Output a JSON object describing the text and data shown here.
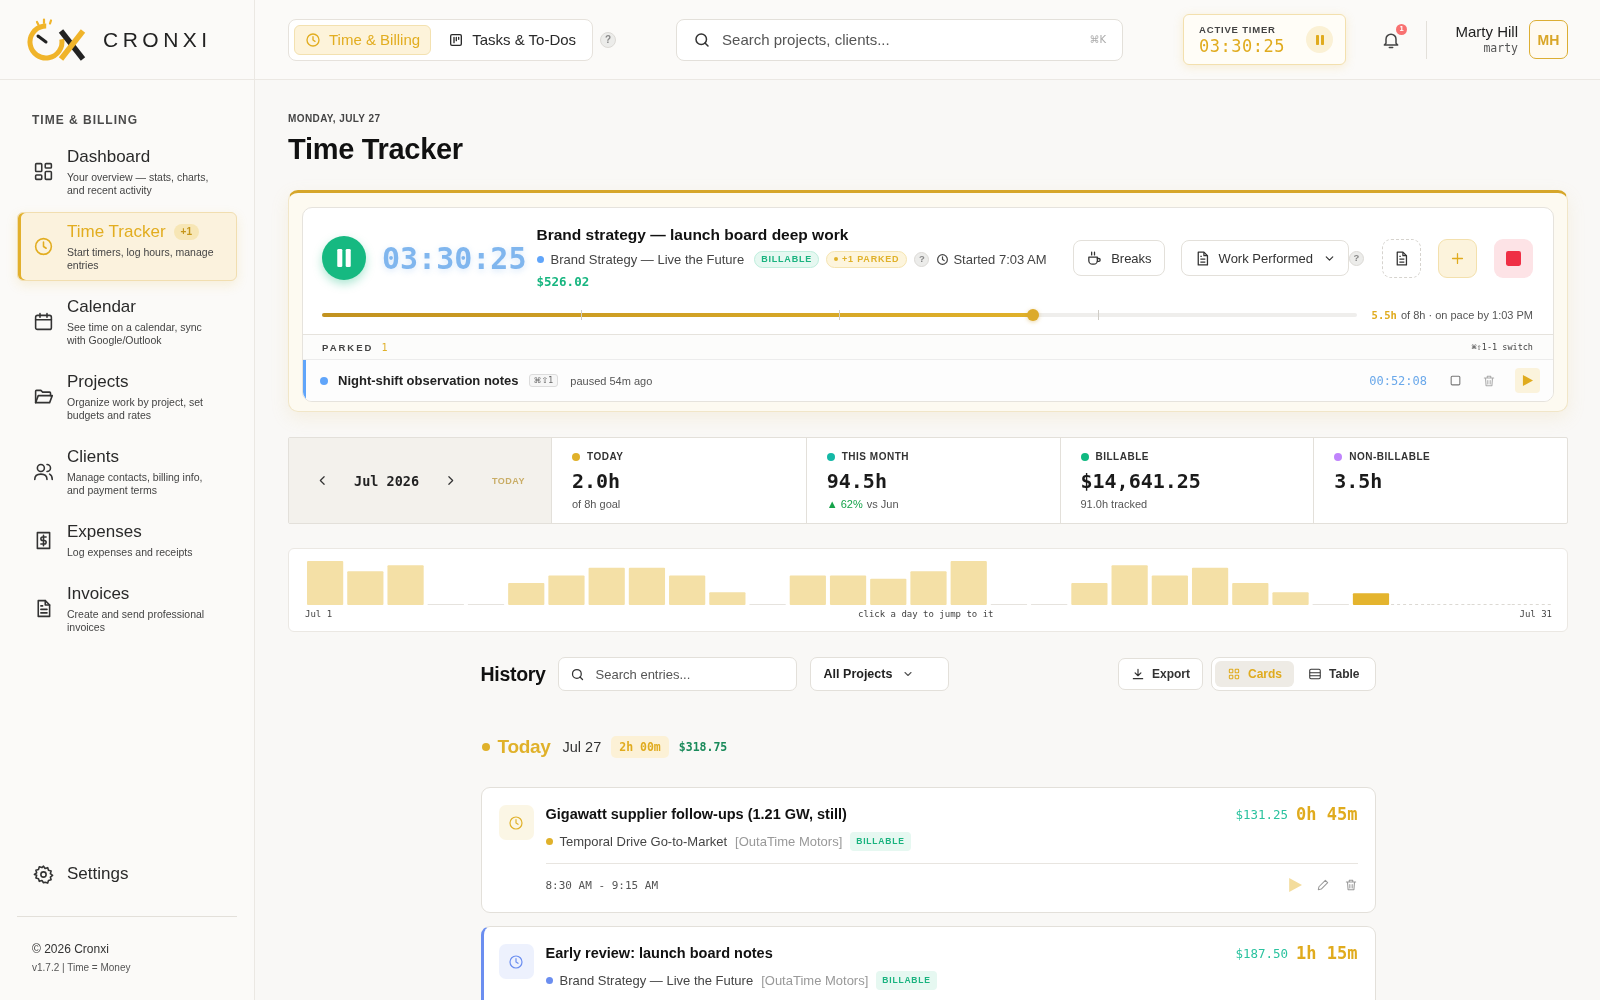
{
  "sidebar": {
    "brand": "CRONXI",
    "section_label": "TIME & BILLING",
    "items": [
      {
        "label": "Dashboard",
        "description": "Your overview — stats, charts, and recent activity",
        "selected": false
      },
      {
        "label": "Time Tracker",
        "badge": "+1",
        "description": "Start timers, log hours, manage entries",
        "selected": true
      },
      {
        "label": "Calendar",
        "description": "See time on a calendar, sync with Google/Outlook",
        "selected": false
      },
      {
        "label": "Projects",
        "description": "Organize work by project, set budgets and rates",
        "selected": false
      },
      {
        "label": "Clients",
        "description": "Manage contacts, billing info, and payment terms",
        "selected": false
      },
      {
        "label": "Expenses",
        "description": "Log expenses and receipts",
        "selected": false
      },
      {
        "label": "Invoices",
        "description": "Create and send professional invoices",
        "selected": false
      }
    ],
    "settings": "Settings",
    "copyright": "© 2026 Cronxi",
    "version": "v1.7.2 | Time = Money"
  },
  "topbar": {
    "modules": [
      {
        "label": "Time & Billing",
        "selected": true
      },
      {
        "label": "Tasks & To-Dos",
        "selected": false
      }
    ],
    "help": "?",
    "search": {
      "placeholder": "Search projects, clients...",
      "shortcut": "⌘K"
    },
    "active_timer": {
      "label": "ACTIVE TIMER",
      "time": "03:30:25",
      "running": true
    },
    "notifications": {
      "count": "1"
    },
    "user": {
      "name": "Marty Hill",
      "username": "marty",
      "initials": "MH"
    }
  },
  "page": {
    "date": "MONDAY, JULY 27",
    "title": "Time Tracker"
  },
  "running_timer": {
    "running": true,
    "time": "03:30:25",
    "title": "Brand strategy — launch board deep work",
    "project": "Brand Strategy — Live the Future",
    "color": "#60a5fa",
    "tag": "BILLABLE",
    "parked_badge": "+1 PARKED",
    "help": "?",
    "started": "Started 7:03 AM",
    "amount": "$526.02",
    "breaks": "Breaks",
    "work_performed": "Work Performed",
    "work_help": "?",
    "progress": {
      "level": 0.6875,
      "done": "5.5h",
      "note": "of 8h · on pace by 1:03 PM"
    }
  },
  "parked": {
    "label": "PARKED",
    "count": "1",
    "hint": "⌘⇧1-1 switch",
    "items": [
      {
        "title": "Night-shift observation notes",
        "shortcut": "⌘⇧1",
        "status": "paused 54m ago",
        "time": "00:52:08",
        "color": "#60a5fa"
      }
    ]
  },
  "month_nav": {
    "label": "Jul 2026",
    "today_button": "TODAY",
    "disabled": true
  },
  "stats": [
    {
      "label": "TODAY",
      "value": "2.0h",
      "sub": "of 8h goal",
      "color": "#e0b12a"
    },
    {
      "label": "THIS MONTH",
      "value": "94.5h",
      "trend": "▲ 62%",
      "sub": "vs Jun",
      "color": "#14b8a6"
    },
    {
      "label": "BILLABLE",
      "value": "$14,641.25",
      "sub": "91.0h tracked",
      "color": "#10b981"
    },
    {
      "label": "NON-BILLABLE",
      "value": "3.5h",
      "color": "#c084fc"
    }
  ],
  "daily_chart": {
    "start_label": "Jul 1",
    "hint": "click a day to jump to it",
    "end_label": "Jul 31"
  },
  "history": {
    "title": "History",
    "search": {
      "placeholder": "Search entries..."
    },
    "project_filter": "All Projects",
    "export": "Export",
    "views": [
      {
        "label": "Cards",
        "selected": true
      },
      {
        "label": "Table",
        "selected": false
      }
    ],
    "groups": [
      {
        "label": "Today",
        "today": true,
        "date": "Jul 27",
        "duration": "2h 00m",
        "amount": "$318.75",
        "entries": [
          {
            "title": "Gigawatt supplier follow-ups (1.21 GW, still)",
            "project": "Temporal Drive Go-to-Market",
            "client": "[OutaTime Motors]",
            "tag": "BILLABLE",
            "color": "#e0b12a",
            "highlighted": false,
            "amount": "$131.25",
            "duration": "0h 45m",
            "time_range": "8:30 AM - 9:15 AM"
          },
          {
            "title": "Early review: launch board notes",
            "project": "Brand Strategy — Live the Future",
            "client": "[OutaTime Motors]",
            "tag": "BILLABLE",
            "color": "#6b8ef0",
            "highlighted": true,
            "amount": "$187.50",
            "duration": "1h 15m"
          }
        ]
      }
    ]
  }
}
